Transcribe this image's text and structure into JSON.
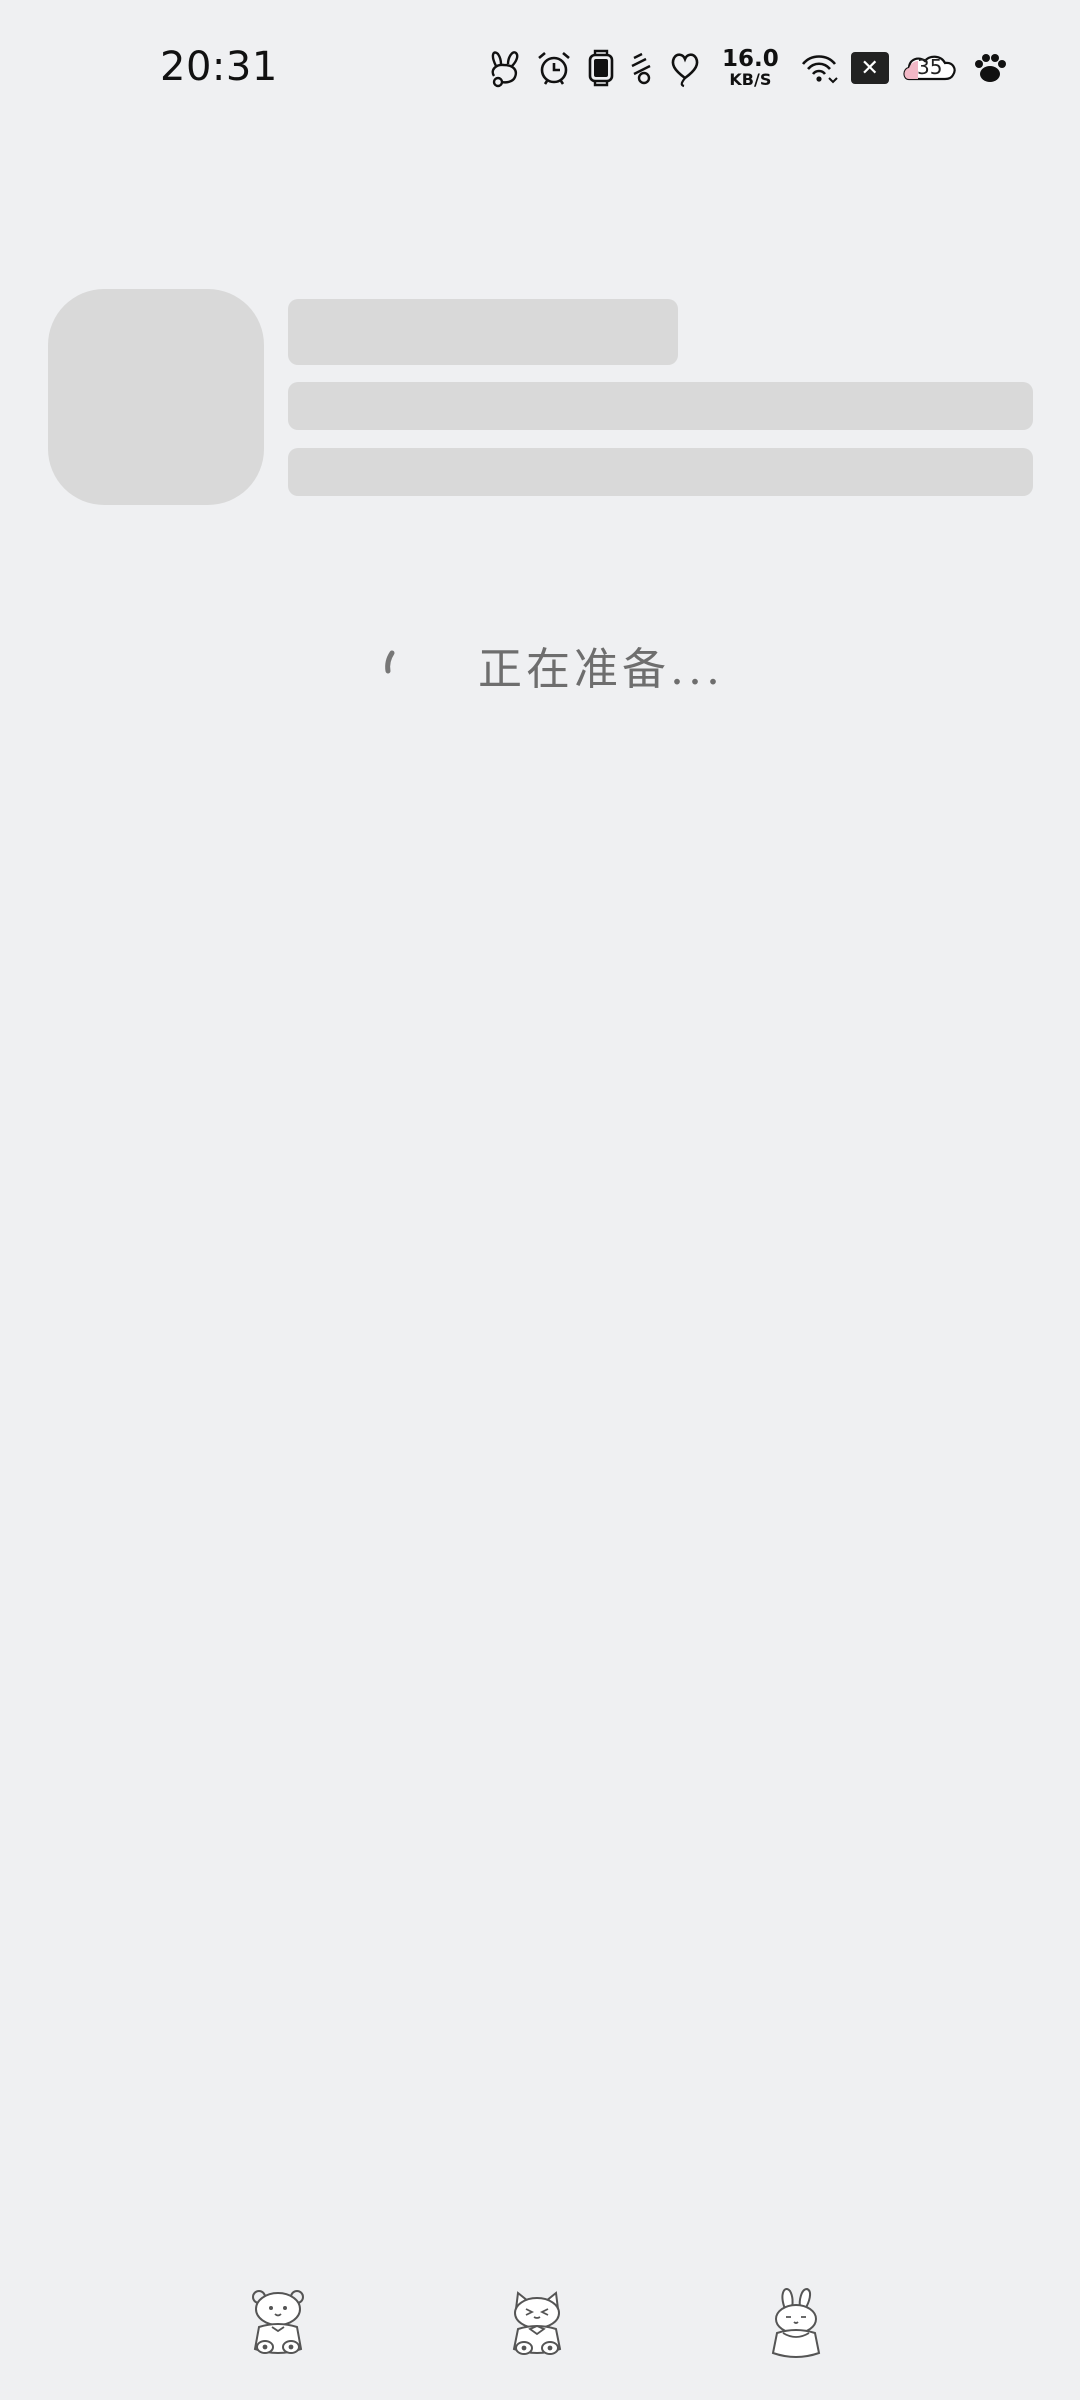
{
  "status_bar": {
    "time": "20:31",
    "net_speed_value": "16.0",
    "net_speed_unit": "KB/S",
    "battery_level": "35",
    "icons": [
      "bunny-icon",
      "alarm-icon",
      "watch-icon",
      "vibrate-icon",
      "heart-icon",
      "wifi-icon",
      "close-badge-icon",
      "battery-icon",
      "paw-icon"
    ]
  },
  "loading": {
    "text": "正在准备..."
  },
  "navigation": {
    "back_icon": "bear-icon",
    "home_icon": "cat-icon",
    "recent_icon": "rabbit-icon"
  },
  "colors": {
    "background": "#eff0f2",
    "skeleton": "#d9d9d9",
    "loading_text": "#6e6e6e"
  }
}
